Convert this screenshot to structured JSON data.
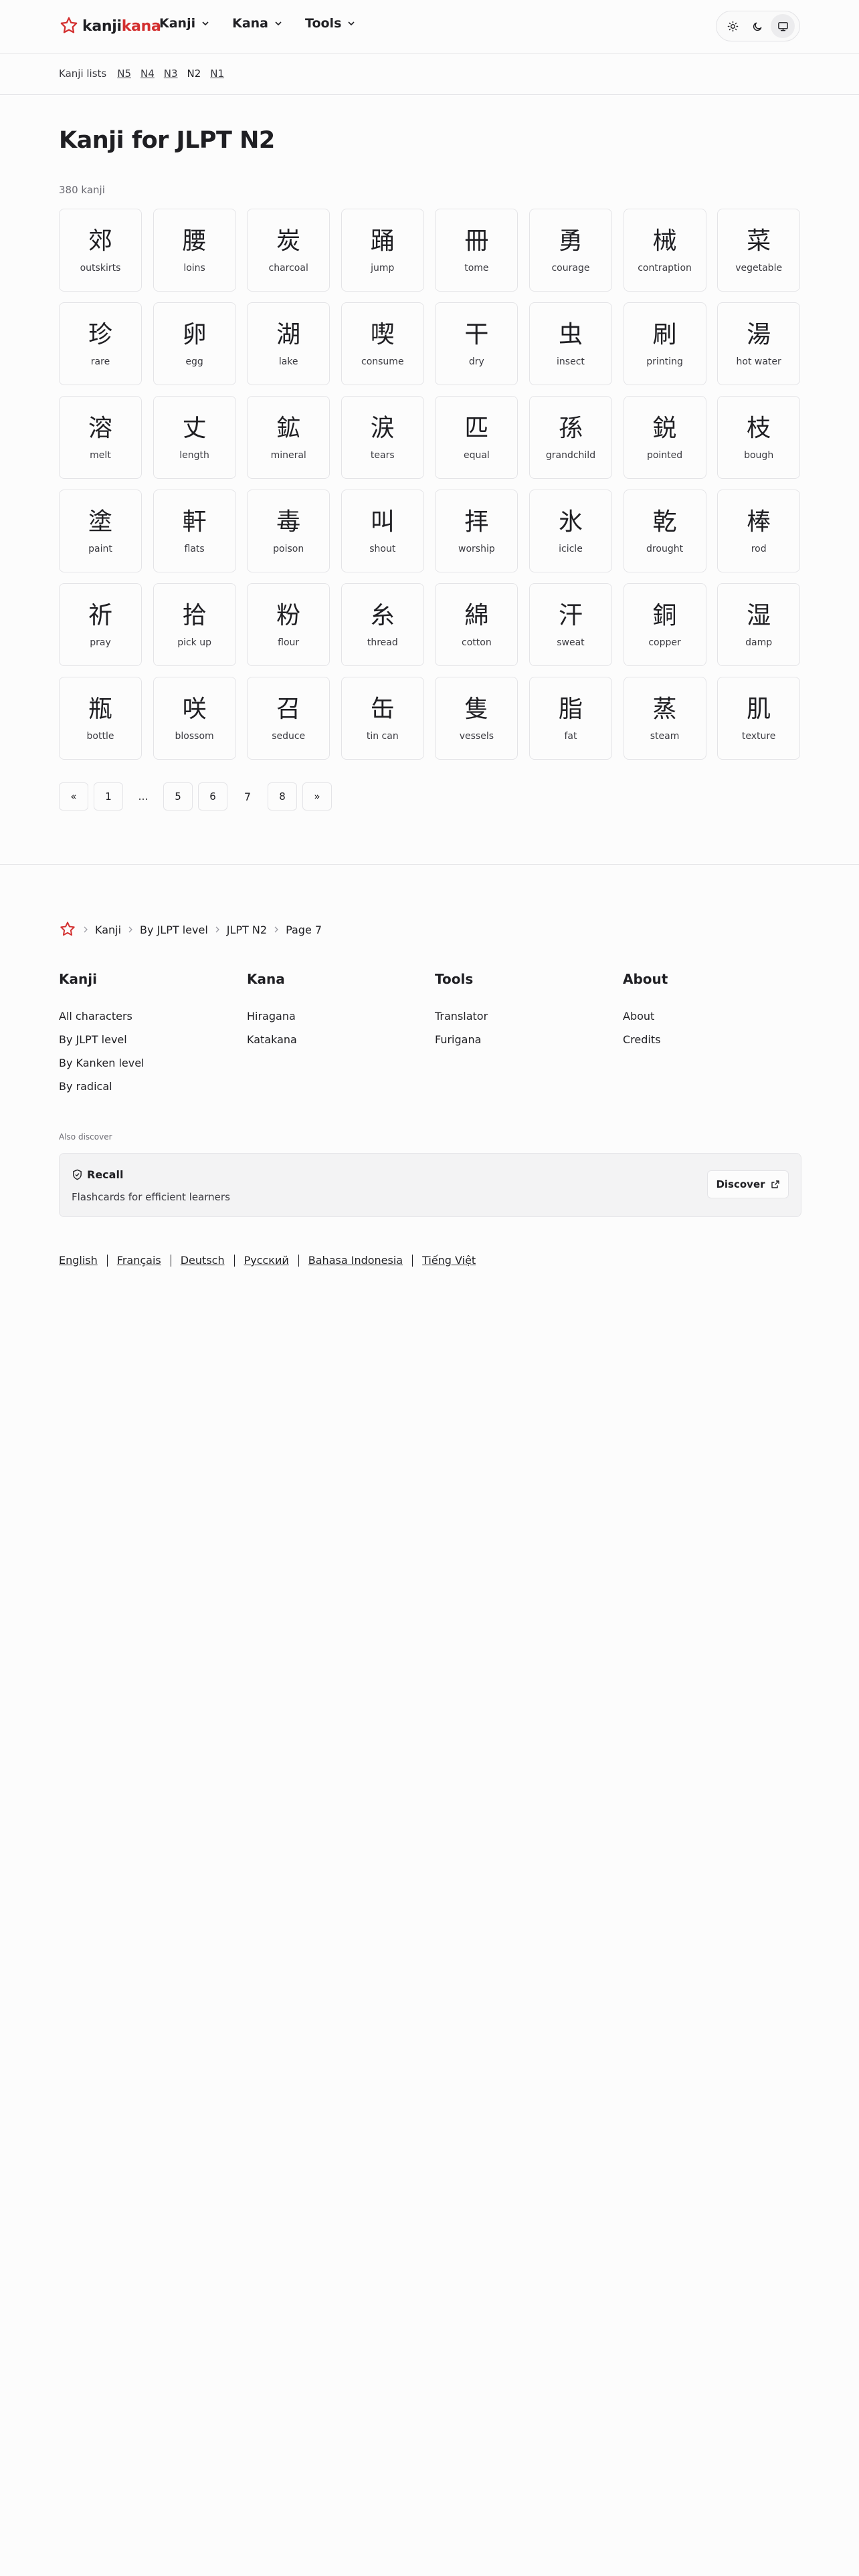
{
  "header": {
    "logo_kanji": "kanji",
    "logo_kana": "kana",
    "nav": [
      {
        "label": "Kanji"
      },
      {
        "label": "Kana"
      },
      {
        "label": "Tools"
      }
    ],
    "theme_options": [
      "light",
      "dark",
      "system"
    ],
    "theme_selected": "system"
  },
  "subnav": {
    "label": "Kanji lists",
    "levels": [
      "N5",
      "N4",
      "N3",
      "N2",
      "N1"
    ],
    "current": "N2"
  },
  "main": {
    "title": "Kanji for JLPT N2",
    "count": "380 kanji",
    "kanji": [
      {
        "char": "郊",
        "meaning": "outskirts"
      },
      {
        "char": "腰",
        "meaning": "loins"
      },
      {
        "char": "炭",
        "meaning": "charcoal"
      },
      {
        "char": "踊",
        "meaning": "jump"
      },
      {
        "char": "冊",
        "meaning": "tome"
      },
      {
        "char": "勇",
        "meaning": "courage"
      },
      {
        "char": "械",
        "meaning": "contraption"
      },
      {
        "char": "菜",
        "meaning": "vegetable"
      },
      {
        "char": "珍",
        "meaning": "rare"
      },
      {
        "char": "卵",
        "meaning": "egg"
      },
      {
        "char": "湖",
        "meaning": "lake"
      },
      {
        "char": "喫",
        "meaning": "consume"
      },
      {
        "char": "干",
        "meaning": "dry"
      },
      {
        "char": "虫",
        "meaning": "insect"
      },
      {
        "char": "刷",
        "meaning": "printing"
      },
      {
        "char": "湯",
        "meaning": "hot water"
      },
      {
        "char": "溶",
        "meaning": "melt"
      },
      {
        "char": "丈",
        "meaning": "length"
      },
      {
        "char": "鉱",
        "meaning": "mineral"
      },
      {
        "char": "涙",
        "meaning": "tears"
      },
      {
        "char": "匹",
        "meaning": "equal"
      },
      {
        "char": "孫",
        "meaning": "grandchild"
      },
      {
        "char": "鋭",
        "meaning": "pointed"
      },
      {
        "char": "枝",
        "meaning": "bough"
      },
      {
        "char": "塗",
        "meaning": "paint"
      },
      {
        "char": "軒",
        "meaning": "flats"
      },
      {
        "char": "毒",
        "meaning": "poison"
      },
      {
        "char": "叫",
        "meaning": "shout"
      },
      {
        "char": "拝",
        "meaning": "worship"
      },
      {
        "char": "氷",
        "meaning": "icicle"
      },
      {
        "char": "乾",
        "meaning": "drought"
      },
      {
        "char": "棒",
        "meaning": "rod"
      },
      {
        "char": "祈",
        "meaning": "pray"
      },
      {
        "char": "拾",
        "meaning": "pick up"
      },
      {
        "char": "粉",
        "meaning": "flour"
      },
      {
        "char": "糸",
        "meaning": "thread"
      },
      {
        "char": "綿",
        "meaning": "cotton"
      },
      {
        "char": "汗",
        "meaning": "sweat"
      },
      {
        "char": "銅",
        "meaning": "copper"
      },
      {
        "char": "湿",
        "meaning": "damp"
      },
      {
        "char": "瓶",
        "meaning": "bottle"
      },
      {
        "char": "咲",
        "meaning": "blossom"
      },
      {
        "char": "召",
        "meaning": "seduce"
      },
      {
        "char": "缶",
        "meaning": "tin can"
      },
      {
        "char": "隻",
        "meaning": "vessels"
      },
      {
        "char": "脂",
        "meaning": "fat"
      },
      {
        "char": "蒸",
        "meaning": "steam"
      },
      {
        "char": "肌",
        "meaning": "texture"
      }
    ]
  },
  "pagination": {
    "prev": "«",
    "next": "»",
    "pages": [
      "1",
      "…",
      "5",
      "6",
      "7",
      "8"
    ],
    "current": "7"
  },
  "footer": {
    "breadcrumb": [
      "Kanji",
      "By JLPT level",
      "JLPT N2",
      "Page 7"
    ],
    "columns": [
      {
        "title": "Kanji",
        "links": [
          "All characters",
          "By JLPT level",
          "By Kanken level",
          "By radical"
        ]
      },
      {
        "title": "Kana",
        "links": [
          "Hiragana",
          "Katakana"
        ]
      },
      {
        "title": "Tools",
        "links": [
          "Translator",
          "Furigana"
        ]
      },
      {
        "title": "About",
        "links": [
          "About",
          "Credits"
        ]
      }
    ],
    "also_discover": "Also discover",
    "promo": {
      "title": "Recall",
      "subtitle": "Flashcards for efficient learners",
      "button": "Discover"
    },
    "languages": [
      "English",
      "Français",
      "Deutsch",
      "Русский",
      "Bahasa Indonesia",
      "Tiếng Việt"
    ]
  },
  "colors": {
    "brand_red": "#d32f2f",
    "text": "#1f1f23",
    "border": "#e4e4e7"
  }
}
